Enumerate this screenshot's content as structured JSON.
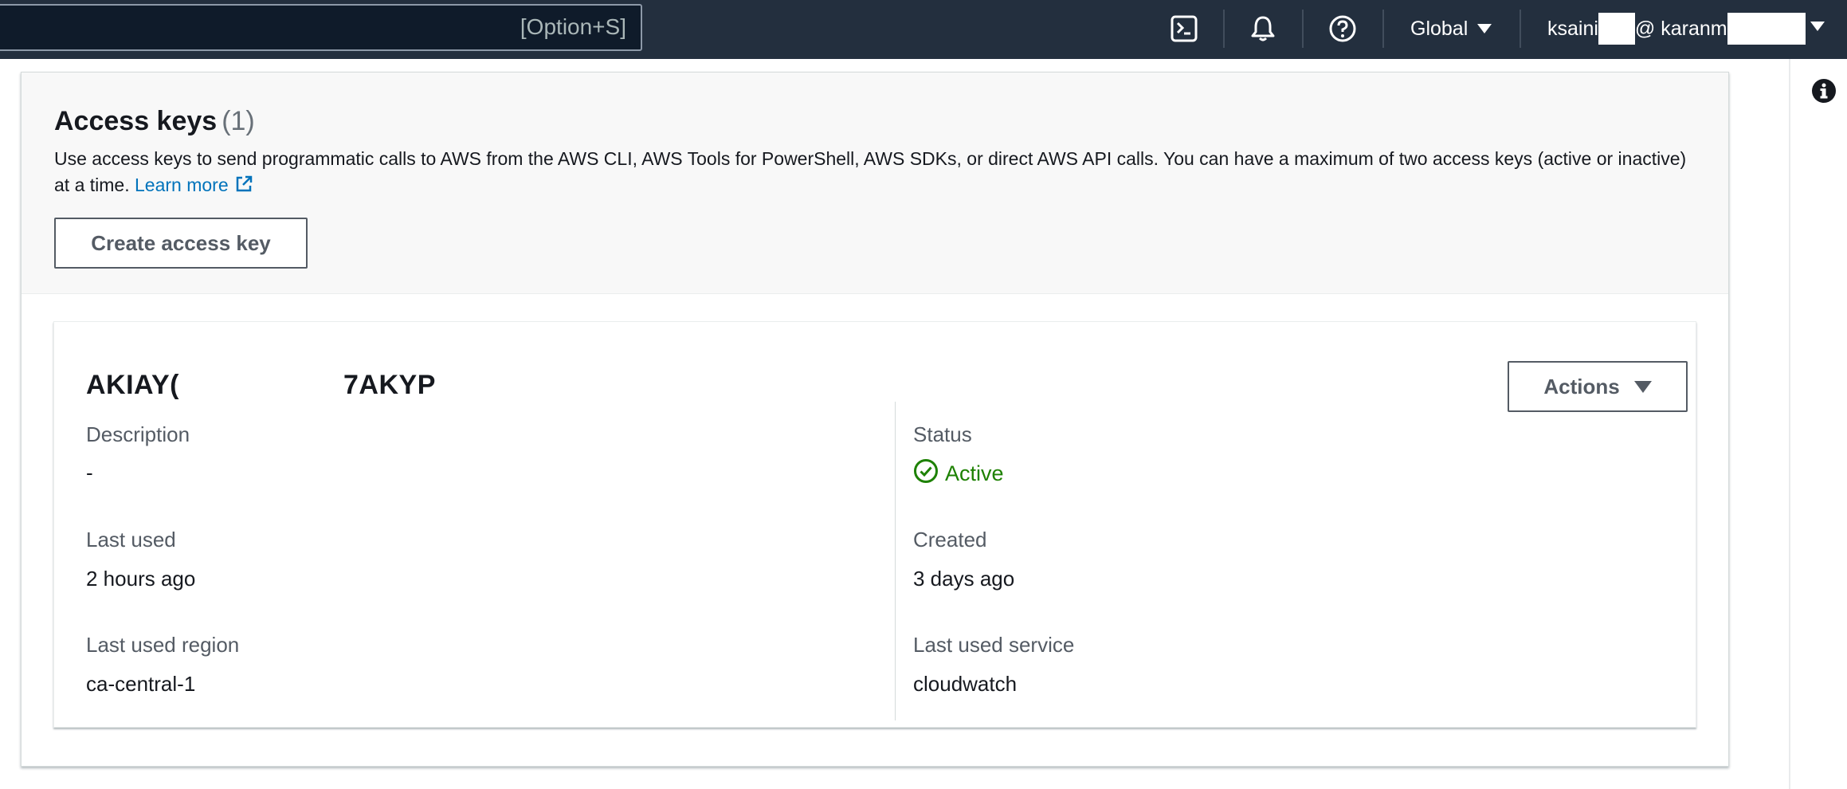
{
  "topbar": {
    "search_shortcut": "[Option+S]",
    "region": "Global",
    "account_user": "ksaini",
    "account_at": "@ karanm"
  },
  "panel": {
    "title": "Access keys",
    "count": "(1)",
    "description": "Use access keys to send programmatic calls to AWS from the AWS CLI, AWS Tools for PowerShell, AWS SDKs, or direct AWS API calls. You can have a maximum of two access keys (active or inactive) at a time.",
    "learn_more": "Learn more",
    "create_button": "Create access key"
  },
  "key": {
    "id_prefix": "AKIAY(",
    "id_suffix": "7AKYP",
    "actions_button": "Actions",
    "description_label": "Description",
    "description_value": "-",
    "status_label": "Status",
    "status_value": "Active",
    "last_used_label": "Last used",
    "last_used_value": "2 hours ago",
    "created_label": "Created",
    "created_value": "3 days ago",
    "region_label": "Last used region",
    "region_value": "ca-central-1",
    "service_label": "Last used service",
    "service_value": "cloudwatch"
  },
  "colors": {
    "nav_bg": "#232f3e",
    "link": "#0073bb",
    "status_green": "#1d8102"
  },
  "icons": [
    "cloudshell-icon",
    "bell-icon",
    "help-icon",
    "info-icon",
    "external-link-icon",
    "status-check-icon"
  ]
}
